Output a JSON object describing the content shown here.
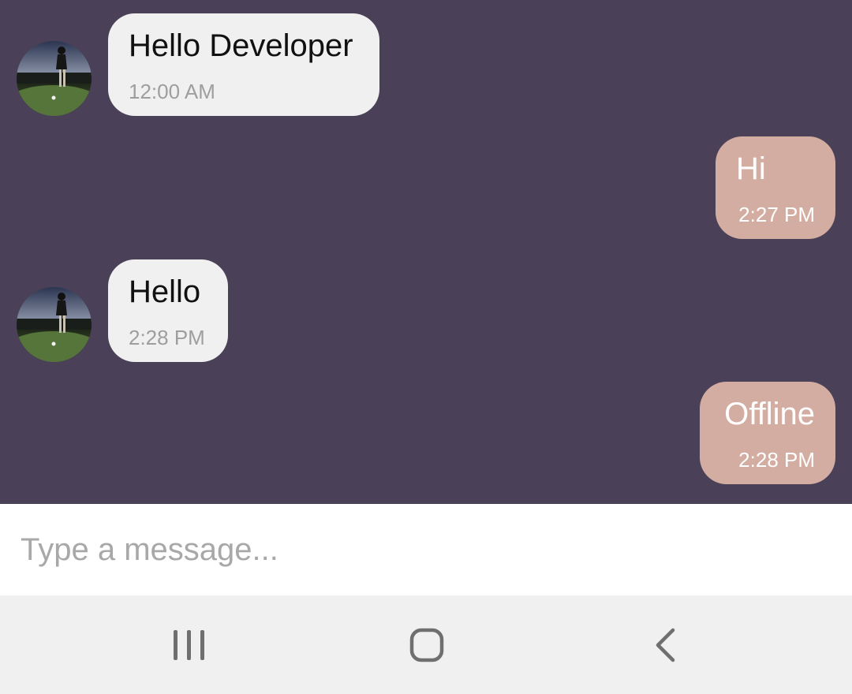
{
  "messages": [
    {
      "direction": "incoming",
      "text": "Hello Developer",
      "time": "12:00 AM",
      "avatar": "golfer-avatar"
    },
    {
      "direction": "outgoing",
      "text": "Hi",
      "time": "2:27 PM"
    },
    {
      "direction": "incoming",
      "text": "Hello",
      "time": "2:28 PM",
      "avatar": "golfer-avatar"
    },
    {
      "direction": "outgoing",
      "text": "Offline",
      "time": "2:28 PM"
    }
  ],
  "composer": {
    "placeholder": "Type a message..."
  },
  "navbar": {
    "buttons": [
      {
        "icon": "recent-apps-icon"
      },
      {
        "icon": "home-icon"
      },
      {
        "icon": "back-icon"
      }
    ]
  },
  "colors": {
    "chat_background": "#4a4158",
    "incoming_bubble": "#f0f0f0",
    "outgoing_bubble": "#d4ada2",
    "timestamp_incoming": "#9e9e9e"
  }
}
